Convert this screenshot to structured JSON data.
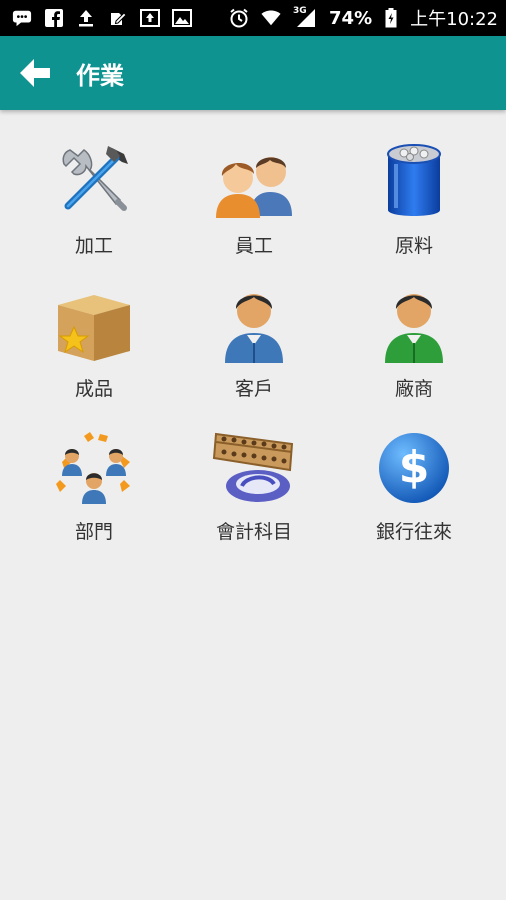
{
  "status_bar": {
    "battery_percent": "74%",
    "time": "上午10:22",
    "network": "3G",
    "icons": [
      "message-icon",
      "facebook-icon",
      "upload-icon",
      "edit-icon",
      "upload-box-icon",
      "image-icon",
      "alarm-icon",
      "wifi-icon",
      "signal-icon",
      "battery-icon"
    ]
  },
  "app_bar": {
    "title": "作業",
    "back_icon": "arrow-left-icon",
    "color": "#0f9391"
  },
  "grid": {
    "items": [
      {
        "label": "加工",
        "icon": "tools-icon"
      },
      {
        "label": "員工",
        "icon": "employees-icon"
      },
      {
        "label": "原料",
        "icon": "material-barrel-icon"
      },
      {
        "label": "成品",
        "icon": "product-box-icon"
      },
      {
        "label": "客戶",
        "icon": "customer-icon"
      },
      {
        "label": "廠商",
        "icon": "supplier-icon"
      },
      {
        "label": "部門",
        "icon": "department-icon"
      },
      {
        "label": "會計科目",
        "icon": "abacus-icon"
      },
      {
        "label": "銀行往來",
        "icon": "dollar-icon"
      }
    ]
  }
}
